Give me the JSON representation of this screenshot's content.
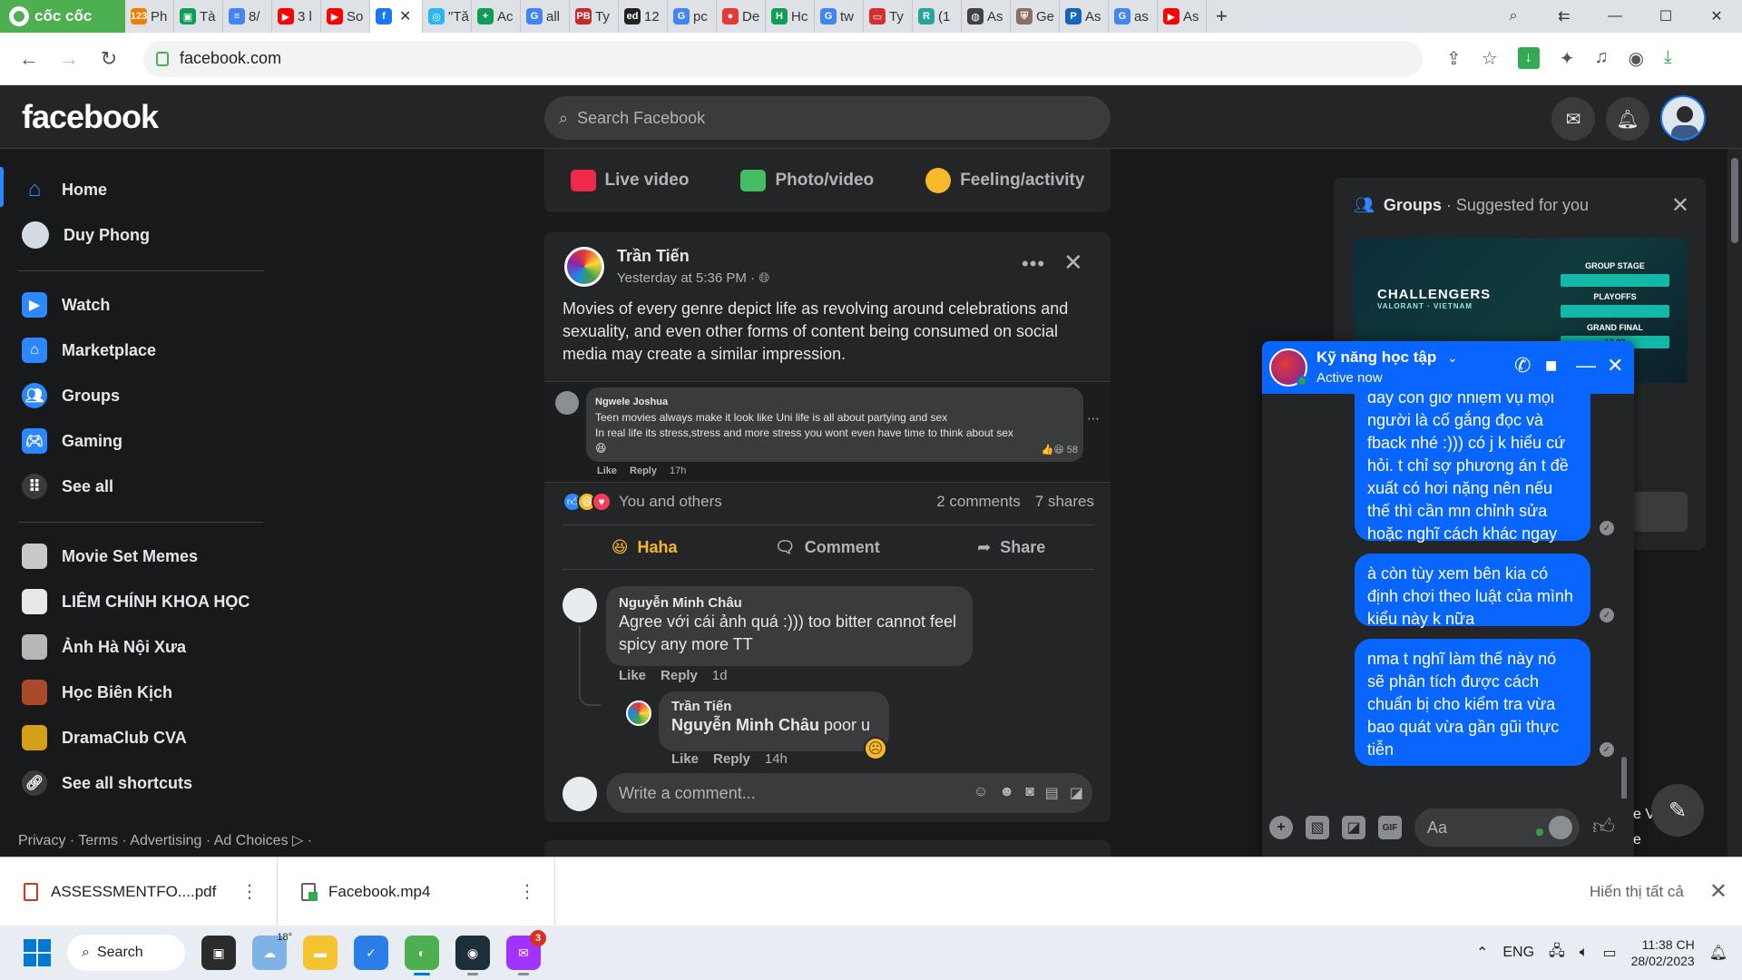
{
  "browser": {
    "brand": "cốc cốc",
    "tabs": [
      {
        "label": "Ph",
        "icon": "123-icon",
        "color": "#f57c00",
        "glyph": "123"
      },
      {
        "label": "Tà",
        "icon": "classroom-icon",
        "color": "#0f9d58",
        "glyph": "▣"
      },
      {
        "label": "8/",
        "icon": "docs-icon",
        "color": "#4285f4",
        "glyph": "≡"
      },
      {
        "label": "3 l",
        "icon": "youtube-icon",
        "color": "#ff0000",
        "glyph": "▶"
      },
      {
        "label": "So",
        "icon": "youtube-icon",
        "color": "#ff0000",
        "glyph": "▶"
      },
      {
        "label": "",
        "icon": "facebook-icon",
        "color": "#1877f2",
        "glyph": "f",
        "active": true
      },
      {
        "label": "\"Tă",
        "icon": "globe-icon",
        "color": "#29b6f6",
        "glyph": "◎"
      },
      {
        "label": "Ac",
        "icon": "sheets-icon",
        "color": "#0f9d58",
        "glyph": "+"
      },
      {
        "label": "all",
        "icon": "google-icon",
        "color": "#4285f4",
        "glyph": "G"
      },
      {
        "label": "Ty",
        "icon": "pb-icon",
        "color": "#c62828",
        "glyph": "PB"
      },
      {
        "label": "12",
        "icon": "ed-icon",
        "color": "#222222",
        "glyph": "ed"
      },
      {
        "label": "pc",
        "icon": "google-icon",
        "color": "#4285f4",
        "glyph": "G"
      },
      {
        "label": "De",
        "icon": "red-app-icon",
        "color": "#e53935",
        "glyph": "●"
      },
      {
        "label": "Hc",
        "icon": "sheets-icon",
        "color": "#0f9d58",
        "glyph": "H"
      },
      {
        "label": "tw",
        "icon": "google-icon",
        "color": "#4285f4",
        "glyph": "G"
      },
      {
        "label": "Ty",
        "icon": "slides-icon",
        "color": "#d32f2f",
        "glyph": "▭"
      },
      {
        "label": "(1",
        "icon": "r-icon",
        "color": "#26a69a",
        "glyph": "R"
      },
      {
        "label": "As",
        "icon": "globe-dark-icon",
        "color": "#424242",
        "glyph": "◍"
      },
      {
        "label": "Ge",
        "icon": "shield-icon",
        "color": "#8d6e63",
        "glyph": "⛨"
      },
      {
        "label": "As",
        "icon": "p-icon",
        "color": "#1565c0",
        "glyph": "P"
      },
      {
        "label": "as",
        "icon": "google-icon",
        "color": "#4285f4",
        "glyph": "G"
      },
      {
        "label": "As",
        "icon": "youtube-icon",
        "color": "#ff0000",
        "glyph": "▶"
      }
    ],
    "url": "facebook.com"
  },
  "fb": {
    "logo": "facebook",
    "search_placeholder": "Search Facebook",
    "nav": {
      "home": "Home",
      "profile": "Duy Phong",
      "watch": "Watch",
      "marketplace": "Marketplace",
      "groups": "Groups",
      "gaming": "Gaming",
      "see_all": "See all"
    },
    "shortcuts": [
      "Movie Set Memes",
      "LIÊM CHÍNH KHOA HỌC",
      "Ảnh Hà Nội Xưa",
      "Học Biên Kịch",
      "DramaClub CVA"
    ],
    "see_all_shortcuts": "See all shortcuts",
    "footer": "Privacy · Terms · Advertising · Ad Choices ▷ ·",
    "composer": {
      "live": "Live video",
      "photo": "Photo/video",
      "feeling": "Feeling/activity"
    }
  },
  "post": {
    "author": "Trần Tiến",
    "time": "Yesterday at 5:36 PM · ",
    "text": "Movies of every genre depict life as revolving around celebrations and sexuality, and even other forms of content being consumed on social media may create a similar impression.",
    "embed": {
      "name": "Ngwele Joshua",
      "line1": "Teen movies always make it look like Uni life is all about partying and sex",
      "line2": "In real life its stress,stress and more stress you wont even have time to think about sex",
      "reacts": "58",
      "like": "Like",
      "reply": "Reply",
      "time": "17h"
    },
    "reactions_text": "You and others",
    "comments_count": "2 comments",
    "shares_count": "7 shares",
    "actions": {
      "haha": "Haha",
      "comment": "Comment",
      "share": "Share"
    },
    "comments": [
      {
        "name": "Nguyễn Minh Châu",
        "text": "Agree với cái ảnh quá :))) too bitter cannot feel spicy any more TT",
        "like": "Like",
        "reply": "Reply",
        "time": "1d"
      },
      {
        "name": "Trần Tiến",
        "mention": "Nguyễn Minh Châu",
        "text": " poor u",
        "like": "Like",
        "reply": "Reply",
        "time": "14h"
      }
    ],
    "write_placeholder": "Write a comment..."
  },
  "groups_card": {
    "title": "Groups",
    "subtitle": " · Suggested for you",
    "banner": {
      "logo": "CHALLENGERS",
      "sub": "VALORANT · VIETNAM",
      "group_stage": "GROUP STAGE",
      "playoffs": "PLAYOFFS",
      "grand_final": "GRAND FINAL",
      "date": "12.03"
    }
  },
  "chat": {
    "title": "Kỹ năng học tập",
    "status": "Active now",
    "messages": [
      "đấy còn giờ nhiệm vụ mọi người là cố gắng đọc và fback nhé :))) có j k hiểu cứ hỏi. t chỉ sợ phương án t đề xuất có hơi nặng nên nếu thế thì cần mn chỉnh sửa hoặc nghĩ cách khác ngay",
      "à còn tùy xem bên kia có định chơi theo luật của mình kiểu này k nữa",
      "nma t nghĩ làm thế này nó sẽ phân tích được cách chuẩn bị cho kiểm tra vừa bao quát vừa gần gũi thực tiễn"
    ],
    "input_placeholder": "Aa",
    "peek": "e V\ne"
  },
  "downloads": {
    "items": [
      "ASSESSMENTFO....pdf",
      "Facebook.mp4"
    ],
    "show_all": "Hiển thị tất cả"
  },
  "taskbar": {
    "search": "Search",
    "temp": "18°",
    "messenger_badge": "3",
    "lang": "ENG",
    "time": "11:38 CH",
    "date": "28/02/2023"
  }
}
